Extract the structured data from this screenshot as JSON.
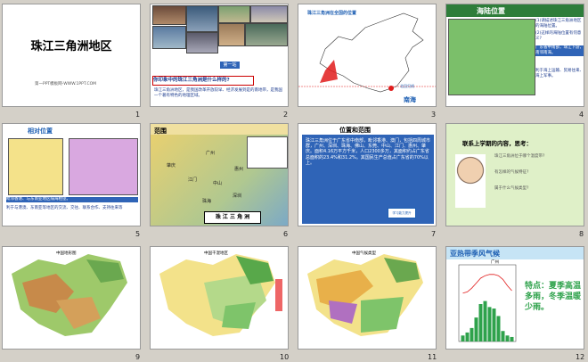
{
  "slides": [
    {
      "number": "1",
      "title": "珠江三角洲地区",
      "subtitle": "第一PPT模板网-WWW.1PPT.COM"
    },
    {
      "number": "2",
      "badge": "第一站",
      "question": "你印象中的珠江三角洲是什么样的?",
      "body": "珠江三角洲地区，是我国改革开放较早、经济发展到是的南地带，是我国一个著有特色的地理区域。"
    },
    {
      "number": "3",
      "map_title": "珠江三角洲在全国的位置",
      "sea_label": "南海",
      "tropic_label": "北回归线"
    },
    {
      "number": "4",
      "title": "海陆位置",
      "q1": "(1)请描述珠江三角洲地区的海陆位置。",
      "q2": "(2)这样的海陆位置有何意义?",
      "answer": "广东省中南部，珠江下游，南邻南海。",
      "meaning": "利于海上运输、贸易往来、海上军事。"
    },
    {
      "number": "5",
      "title": "相对位置",
      "answer": "毗邻香港、与东南亚地区隔海相望。",
      "body": "利于与港澳、东南亚等地区的交流、交往、联系合作、支持往来等"
    },
    {
      "number": "6",
      "title": "范围",
      "places": [
        "清远",
        "肇庆",
        "广州",
        "东莞",
        "惠州",
        "佛山",
        "江门",
        "中山",
        "珠海",
        "深圳",
        "香港",
        "澳门"
      ],
      "legend": "珠江三角洲",
      "caption": "珠 江 三 角 洲"
    },
    {
      "number": "7",
      "title": "位置和范围",
      "body": "珠江三角洲位于广东省中南部，毗邻香港、澳门，包括四周城市群，广州、深圳、珠海、佛山、东莞、中山、江门、惠州、肇庆。面积4.16万平方千米，人口2300多万，其面积约占广东省总面积的23.4%和31.2%。其国民生产总值占广东省的70%以上。",
      "button": "学习能力提升"
    },
    {
      "number": "8",
      "title": "联系上学期的内容，思考：",
      "q1": "珠江三角洲位于哪个温度带?",
      "q2": "有怎样的气候特征?",
      "q3": "属于什么气候类型?"
    },
    {
      "number": "9",
      "title": "中国地形图"
    },
    {
      "number": "10",
      "title": "中国干湿地区"
    },
    {
      "number": "11",
      "title": "中国气候类型"
    },
    {
      "number": "12",
      "banner": "亚热带季风气候",
      "city": "广州",
      "feature": "特点：夏季高温多雨，冬季温暖少雨。"
    }
  ],
  "chart_data": {
    "type": "bar",
    "categories": [
      "1",
      "2",
      "3",
      "4",
      "5",
      "6",
      "7",
      "8",
      "9",
      "10",
      "11",
      "12"
    ],
    "values": [
      40,
      60,
      90,
      160,
      250,
      270,
      230,
      220,
      170,
      70,
      40,
      30
    ],
    "ylim": [
      0,
      300
    ],
    "series_line": [
      13,
      14,
      17,
      21,
      25,
      27,
      28,
      28,
      27,
      24,
      19,
      15
    ]
  },
  "colors": {
    "accent": "#2f64b7",
    "title_blue": "#1e5fb3",
    "red": "#e11b1b",
    "green": "#2ea24b"
  }
}
